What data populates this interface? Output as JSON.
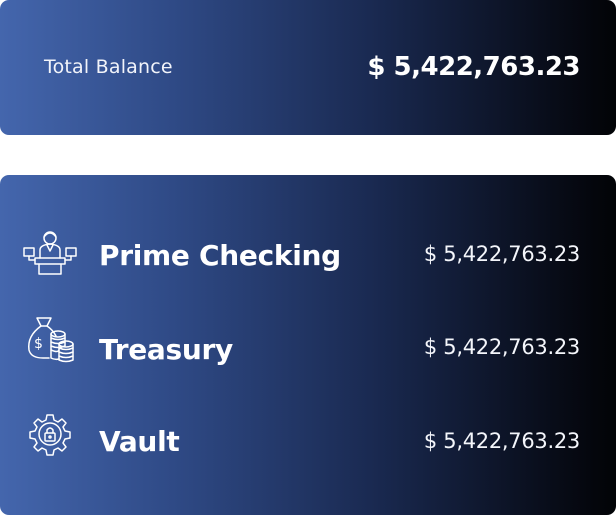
{
  "summary": {
    "label": "Total Balance",
    "value": "$ 5,422,763.23"
  },
  "accounts": [
    {
      "name": "Prime Checking",
      "amount": "$ 5,422,763.23",
      "icon": "banker-at-desk-icon"
    },
    {
      "name": "Treasury",
      "amount": "$ 5,422,763.23",
      "icon": "money-bag-coins-icon"
    },
    {
      "name": "Vault",
      "amount": "$ 5,422,763.23",
      "icon": "gear-lock-icon"
    }
  ],
  "colors": {
    "gradient_start": "#4466ad",
    "gradient_end": "#020306",
    "text": "#ffffff"
  }
}
